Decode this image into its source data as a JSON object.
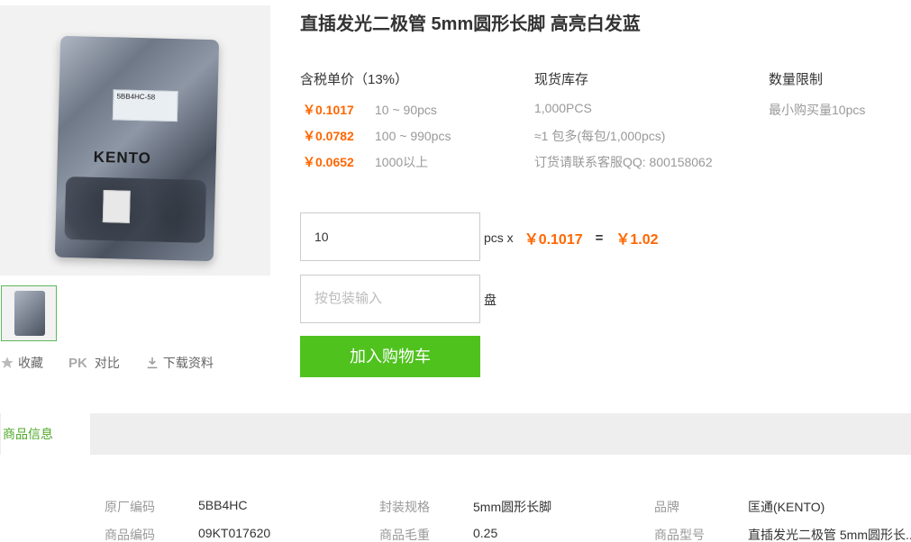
{
  "product": {
    "title": "直插发光二极管 5mm圆形长脚 高亮白发蓝",
    "image": {
      "label_line1": "5BB4HC-58",
      "brand": "KENTO"
    }
  },
  "actions": {
    "favorite": "收藏",
    "pk_badge": "PK",
    "compare": "对比",
    "download": "下载资料"
  },
  "pricing": {
    "header": "含税单价（13%）",
    "tiers": [
      {
        "price": "￥0.1017",
        "range": "10 ~ 90pcs"
      },
      {
        "price": "￥0.0782",
        "range": "100 ~ 990pcs"
      },
      {
        "price": "￥0.0652",
        "range": "1000以上"
      }
    ]
  },
  "stock": {
    "header": "现货库存",
    "lines": [
      "1,000PCS",
      "≈1 包多(每包/1,000pcs)",
      "订货请联系客服QQ: 800158062"
    ]
  },
  "limit": {
    "header": "数量限制",
    "text": "最小购买量10pcs"
  },
  "order": {
    "quantity_value": "10",
    "unit": "pcs x",
    "unit_price": "￥0.1017",
    "equals": "=",
    "total": "￥1.02",
    "package_placeholder": "按包装输入",
    "package_unit": "盘",
    "add_to_cart": "加入购物车"
  },
  "tabs": {
    "active": "商品信息"
  },
  "specs": {
    "col1": [
      {
        "label": "原厂编码",
        "value": "5BB4HC"
      },
      {
        "label": "商品编码",
        "value": "09KT017620"
      }
    ],
    "col2": [
      {
        "label": "封装规格",
        "value": "5mm圆形长脚"
      },
      {
        "label": "商品毛重",
        "value": "0.25"
      }
    ],
    "col3": [
      {
        "label": "品牌",
        "value": "匡通(KENTO)"
      },
      {
        "label": "商品型号",
        "value": "直插发光二极管 5mm圆形长..."
      }
    ]
  },
  "colors": {
    "accent_green": "#4fc21e",
    "price_orange": "#ff6600"
  }
}
